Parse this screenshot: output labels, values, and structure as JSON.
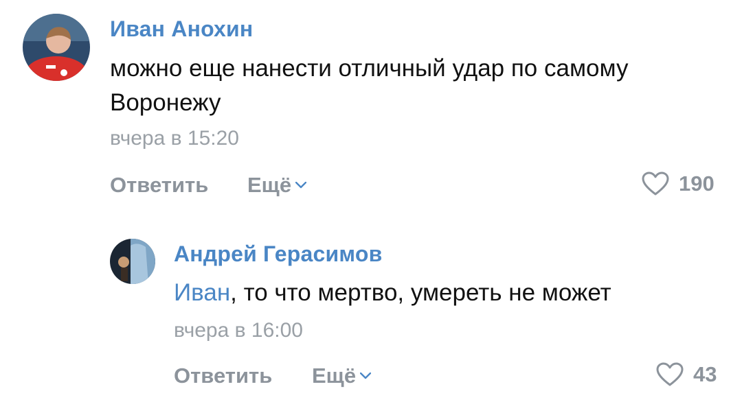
{
  "comments": [
    {
      "author": "Иван Анохин",
      "text_line1": "можно еще нанести отличный удар по самому",
      "text_line2": "Воронежу",
      "time": "вчера в 15:20",
      "reply_label": "Ответить",
      "more_label": "Ещё",
      "likes": "190"
    },
    {
      "author": "Андрей Герасимов",
      "mention": "Иван",
      "text_rest": ", то что мертво, умереть не может",
      "time": "вчера в 16:00",
      "reply_label": "Ответить",
      "more_label": "Ещё",
      "likes": "43"
    }
  ],
  "colors": {
    "accent": "#4a86c5",
    "muted": "#8c939b",
    "time": "#9aa0a6"
  },
  "icons": {
    "like": "heart-outline-icon",
    "more": "chevron-down-icon"
  }
}
